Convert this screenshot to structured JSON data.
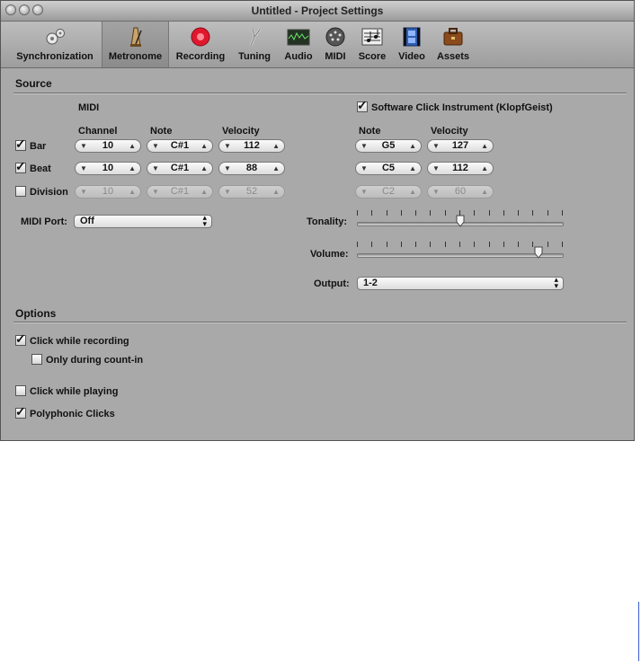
{
  "window": {
    "title": "Untitled - Project Settings"
  },
  "toolbar": {
    "tabs": [
      {
        "label": "Synchronization",
        "icon": "gears-icon"
      },
      {
        "label": "Metronome",
        "icon": "metronome-icon"
      },
      {
        "label": "Recording",
        "icon": "record-icon"
      },
      {
        "label": "Tuning",
        "icon": "tuning-fork-icon"
      },
      {
        "label": "Audio",
        "icon": "audio-meter-icon"
      },
      {
        "label": "MIDI",
        "icon": "midi-port-icon"
      },
      {
        "label": "Score",
        "icon": "score-icon"
      },
      {
        "label": "Video",
        "icon": "video-film-icon"
      },
      {
        "label": "Assets",
        "icon": "briefcase-icon"
      }
    ],
    "selected": "Metronome"
  },
  "source": {
    "heading": "Source",
    "midi_heading": "MIDI",
    "col_channel": "Channel",
    "col_note": "Note",
    "col_velocity": "Velocity",
    "rows": [
      {
        "label": "Bar",
        "checked": true,
        "channel": "10",
        "note": "C#1",
        "velocity": "112"
      },
      {
        "label": "Beat",
        "checked": true,
        "channel": "10",
        "note": "C#1",
        "velocity": "88"
      },
      {
        "label": "Division",
        "checked": false,
        "channel": "10",
        "note": "C#1",
        "velocity": "52"
      }
    ],
    "midi_port_label": "MIDI Port:",
    "midi_port_value": "Off",
    "software_click": {
      "label": "Software Click Instrument (KlopfGeist)",
      "checked": true,
      "col_note": "Note",
      "col_velocity": "Velocity",
      "rows": [
        {
          "note": "G5",
          "velocity": "127"
        },
        {
          "note": "C5",
          "velocity": "112"
        },
        {
          "note": "C2",
          "velocity": "60"
        }
      ]
    },
    "tonality_label": "Tonality:",
    "tonality_value": 0.5,
    "volume_label": "Volume:",
    "volume_value": 0.88,
    "output_label": "Output:",
    "output_value": "1-2"
  },
  "options": {
    "heading": "Options",
    "items": [
      {
        "label": "Click while recording",
        "checked": true
      },
      {
        "label": "Only during count-in",
        "checked": false
      },
      {
        "label": "Click while playing",
        "checked": false
      },
      {
        "label": "Polyphonic Clicks",
        "checked": true
      }
    ]
  },
  "colors": {
    "window_bg": "#a9a9a9",
    "record_red": "#e0182d"
  }
}
